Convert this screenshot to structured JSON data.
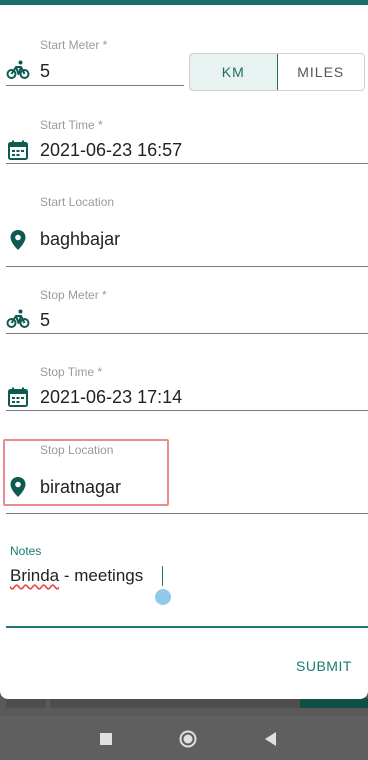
{
  "colors": {
    "accent": "#1a6f66",
    "highlight": "#ee8a8a",
    "icon": "#0f5a50"
  },
  "start_meter": {
    "label": "Start Meter *",
    "value": "5",
    "icon": "bicycle-icon"
  },
  "unit_toggle": {
    "km_label": "KM",
    "miles_label": "MILES",
    "selected": "KM"
  },
  "start_time": {
    "label": "Start Time *",
    "value": "2021-06-23 16:57",
    "icon": "calendar-icon"
  },
  "start_location": {
    "label": "Start Location",
    "value": "baghbajar",
    "icon": "location-pin-icon"
  },
  "stop_meter": {
    "label": "Stop Meter *",
    "value": "5",
    "icon": "bicycle-icon"
  },
  "stop_time": {
    "label": "Stop Time *",
    "value": "2021-06-23 17:14",
    "icon": "calendar-icon"
  },
  "stop_location": {
    "label": "Stop Location",
    "value": "biratnagar",
    "icon": "location-pin-icon"
  },
  "notes": {
    "label": "Notes",
    "value_misspelled": "Brinda",
    "value_rest": " - meetings"
  },
  "actions": {
    "submit_label": "SUBMIT"
  },
  "navbar": {
    "icons": [
      "recent-apps-icon",
      "home-icon",
      "back-icon"
    ]
  }
}
